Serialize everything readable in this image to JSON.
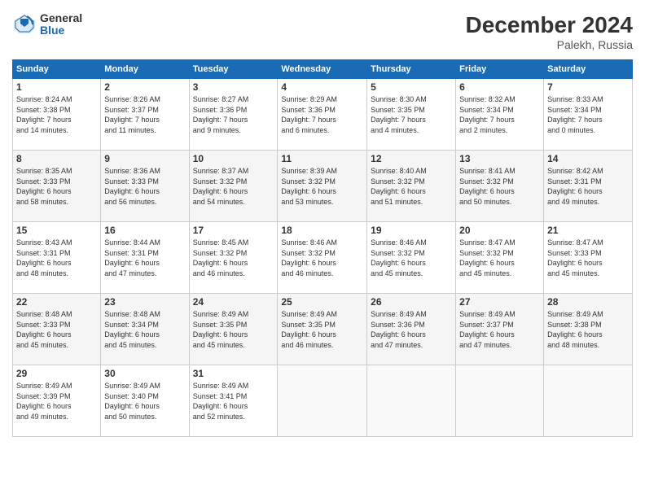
{
  "logo": {
    "general": "General",
    "blue": "Blue"
  },
  "title": "December 2024",
  "subtitle": "Palekh, Russia",
  "days_header": [
    "Sunday",
    "Monday",
    "Tuesday",
    "Wednesday",
    "Thursday",
    "Friday",
    "Saturday"
  ],
  "weeks": [
    [
      {
        "day": "1",
        "info": "Sunrise: 8:24 AM\nSunset: 3:38 PM\nDaylight: 7 hours\nand 14 minutes."
      },
      {
        "day": "2",
        "info": "Sunrise: 8:26 AM\nSunset: 3:37 PM\nDaylight: 7 hours\nand 11 minutes."
      },
      {
        "day": "3",
        "info": "Sunrise: 8:27 AM\nSunset: 3:36 PM\nDaylight: 7 hours\nand 9 minutes."
      },
      {
        "day": "4",
        "info": "Sunrise: 8:29 AM\nSunset: 3:36 PM\nDaylight: 7 hours\nand 6 minutes."
      },
      {
        "day": "5",
        "info": "Sunrise: 8:30 AM\nSunset: 3:35 PM\nDaylight: 7 hours\nand 4 minutes."
      },
      {
        "day": "6",
        "info": "Sunrise: 8:32 AM\nSunset: 3:34 PM\nDaylight: 7 hours\nand 2 minutes."
      },
      {
        "day": "7",
        "info": "Sunrise: 8:33 AM\nSunset: 3:34 PM\nDaylight: 7 hours\nand 0 minutes."
      }
    ],
    [
      {
        "day": "8",
        "info": "Sunrise: 8:35 AM\nSunset: 3:33 PM\nDaylight: 6 hours\nand 58 minutes."
      },
      {
        "day": "9",
        "info": "Sunrise: 8:36 AM\nSunset: 3:33 PM\nDaylight: 6 hours\nand 56 minutes."
      },
      {
        "day": "10",
        "info": "Sunrise: 8:37 AM\nSunset: 3:32 PM\nDaylight: 6 hours\nand 54 minutes."
      },
      {
        "day": "11",
        "info": "Sunrise: 8:39 AM\nSunset: 3:32 PM\nDaylight: 6 hours\nand 53 minutes."
      },
      {
        "day": "12",
        "info": "Sunrise: 8:40 AM\nSunset: 3:32 PM\nDaylight: 6 hours\nand 51 minutes."
      },
      {
        "day": "13",
        "info": "Sunrise: 8:41 AM\nSunset: 3:32 PM\nDaylight: 6 hours\nand 50 minutes."
      },
      {
        "day": "14",
        "info": "Sunrise: 8:42 AM\nSunset: 3:31 PM\nDaylight: 6 hours\nand 49 minutes."
      }
    ],
    [
      {
        "day": "15",
        "info": "Sunrise: 8:43 AM\nSunset: 3:31 PM\nDaylight: 6 hours\nand 48 minutes."
      },
      {
        "day": "16",
        "info": "Sunrise: 8:44 AM\nSunset: 3:31 PM\nDaylight: 6 hours\nand 47 minutes."
      },
      {
        "day": "17",
        "info": "Sunrise: 8:45 AM\nSunset: 3:32 PM\nDaylight: 6 hours\nand 46 minutes."
      },
      {
        "day": "18",
        "info": "Sunrise: 8:46 AM\nSunset: 3:32 PM\nDaylight: 6 hours\nand 46 minutes."
      },
      {
        "day": "19",
        "info": "Sunrise: 8:46 AM\nSunset: 3:32 PM\nDaylight: 6 hours\nand 45 minutes."
      },
      {
        "day": "20",
        "info": "Sunrise: 8:47 AM\nSunset: 3:32 PM\nDaylight: 6 hours\nand 45 minutes."
      },
      {
        "day": "21",
        "info": "Sunrise: 8:47 AM\nSunset: 3:33 PM\nDaylight: 6 hours\nand 45 minutes."
      }
    ],
    [
      {
        "day": "22",
        "info": "Sunrise: 8:48 AM\nSunset: 3:33 PM\nDaylight: 6 hours\nand 45 minutes."
      },
      {
        "day": "23",
        "info": "Sunrise: 8:48 AM\nSunset: 3:34 PM\nDaylight: 6 hours\nand 45 minutes."
      },
      {
        "day": "24",
        "info": "Sunrise: 8:49 AM\nSunset: 3:35 PM\nDaylight: 6 hours\nand 45 minutes."
      },
      {
        "day": "25",
        "info": "Sunrise: 8:49 AM\nSunset: 3:35 PM\nDaylight: 6 hours\nand 46 minutes."
      },
      {
        "day": "26",
        "info": "Sunrise: 8:49 AM\nSunset: 3:36 PM\nDaylight: 6 hours\nand 47 minutes."
      },
      {
        "day": "27",
        "info": "Sunrise: 8:49 AM\nSunset: 3:37 PM\nDaylight: 6 hours\nand 47 minutes."
      },
      {
        "day": "28",
        "info": "Sunrise: 8:49 AM\nSunset: 3:38 PM\nDaylight: 6 hours\nand 48 minutes."
      }
    ],
    [
      {
        "day": "29",
        "info": "Sunrise: 8:49 AM\nSunset: 3:39 PM\nDaylight: 6 hours\nand 49 minutes."
      },
      {
        "day": "30",
        "info": "Sunrise: 8:49 AM\nSunset: 3:40 PM\nDaylight: 6 hours\nand 50 minutes."
      },
      {
        "day": "31",
        "info": "Sunrise: 8:49 AM\nSunset: 3:41 PM\nDaylight: 6 hours\nand 52 minutes."
      },
      {
        "day": "",
        "info": ""
      },
      {
        "day": "",
        "info": ""
      },
      {
        "day": "",
        "info": ""
      },
      {
        "day": "",
        "info": ""
      }
    ]
  ]
}
